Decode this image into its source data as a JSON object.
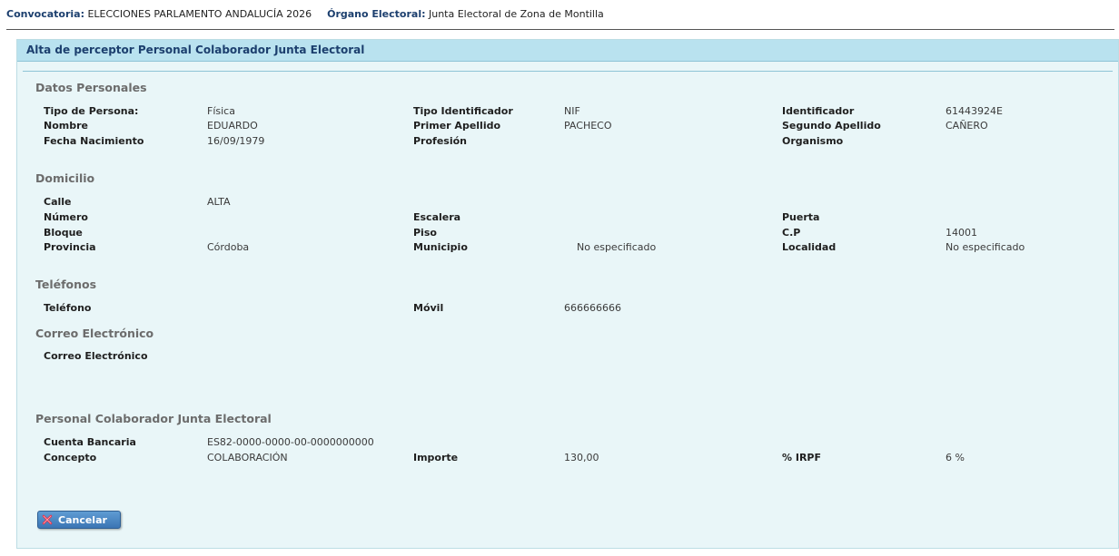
{
  "topbar": {
    "convocatoria_label": "Convocatoria:",
    "convocatoria_value": "ELECCIONES PARLAMENTO ANDALUCÍA 2026",
    "organo_label": "Órgano Electoral:",
    "organo_value": "Junta Electoral de Zona de Montilla"
  },
  "panel": {
    "title": "Alta de perceptor Personal Colaborador Junta Electoral"
  },
  "datos_personales": {
    "heading": "Datos Personales",
    "tipo_persona": {
      "label": "Tipo de Persona:",
      "value": "Física"
    },
    "tipo_identificador": {
      "label": "Tipo Identificador",
      "value": "NIF"
    },
    "identificador": {
      "label": "Identificador",
      "value": "61443924E"
    },
    "nombre": {
      "label": "Nombre",
      "value": "EDUARDO"
    },
    "primer_apellido": {
      "label": "Primer Apellido",
      "value": "PACHECO"
    },
    "segundo_apellido": {
      "label": "Segundo Apellido",
      "value": "CAÑERO"
    },
    "fecha_nacimiento": {
      "label": "Fecha Nacimiento",
      "value": "16/09/1979"
    },
    "profesion": {
      "label": "Profesión",
      "value": ""
    },
    "organismo": {
      "label": "Organismo",
      "value": ""
    }
  },
  "domicilio": {
    "heading": "Domicilio",
    "calle": {
      "label": "Calle",
      "value": "ALTA"
    },
    "numero": {
      "label": "Número",
      "value": ""
    },
    "escalera": {
      "label": "Escalera",
      "value": ""
    },
    "puerta": {
      "label": "Puerta",
      "value": ""
    },
    "bloque": {
      "label": "Bloque",
      "value": ""
    },
    "piso": {
      "label": "Piso",
      "value": ""
    },
    "cp": {
      "label": "C.P",
      "value": "14001"
    },
    "provincia": {
      "label": "Provincia",
      "value": "Córdoba"
    },
    "municipio": {
      "label": "Municipio",
      "value": "No especificado"
    },
    "localidad": {
      "label": "Localidad",
      "value": "No especificado"
    }
  },
  "telefonos": {
    "heading": "Teléfonos",
    "telefono": {
      "label": "Teléfono",
      "value": ""
    },
    "movil": {
      "label": "Móvil",
      "value": "666666666"
    }
  },
  "correo": {
    "heading": "Correo Electrónico",
    "correo": {
      "label": "Correo Electrónico",
      "value": ""
    }
  },
  "colaborador": {
    "heading": "Personal Colaborador Junta Electoral",
    "cuenta": {
      "label": "Cuenta Bancaria",
      "value": "ES82-0000-0000-00-0000000000"
    },
    "concepto": {
      "label": "Concepto",
      "value": "COLABORACIÓN"
    },
    "importe": {
      "label": "Importe",
      "value": "130,00"
    },
    "irpf": {
      "label": "% IRPF",
      "value": "6 %"
    }
  },
  "actions": {
    "cancel_label": "Cancelar",
    "cancel_icon": "close-icon",
    "cancel_icon_color": "#e0314b"
  }
}
